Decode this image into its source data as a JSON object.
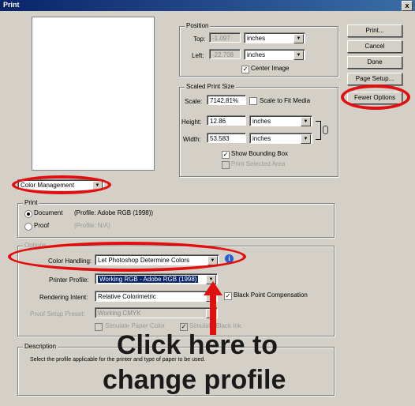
{
  "window": {
    "title": "Print",
    "close_glyph": "x"
  },
  "buttons": {
    "print": "Print...",
    "cancel": "Cancel",
    "done": "Done",
    "page_setup": "Page Setup...",
    "fewer_options": "Fewer Options"
  },
  "position": {
    "group_label": "Position",
    "top_label": "Top:",
    "top_value": "-1.097",
    "top_unit": "inches",
    "left_label": "Left:",
    "left_value": "-22.708",
    "left_unit": "inches",
    "center_image_label": "Center Image"
  },
  "scaled": {
    "group_label": "Scaled Print Size",
    "scale_label": "Scale:",
    "scale_value": "7142.81%",
    "scale_to_fit_label": "Scale to Fit Media",
    "height_label": "Height:",
    "height_value": "12.86",
    "height_unit": "inches",
    "width_label": "Width:",
    "width_value": "53.583",
    "width_unit": "inches",
    "show_bounding_box_label": "Show Bounding Box",
    "print_selected_area_label": "Print Selected Area"
  },
  "mode_dropdown": "Color Management",
  "print_group": {
    "label": "Print",
    "document_label": "Document",
    "document_profile": "(Profile: Adobe RGB (1998))",
    "proof_label": "Proof",
    "proof_profile": "(Profile: N/A)"
  },
  "options": {
    "group_label": "Options",
    "color_handling_label": "Color Handling:",
    "color_handling_value": "Let Photoshop Determine Colors",
    "printer_profile_label": "Printer Profile:",
    "printer_profile_value": "Working RGB - Adobe RGB (1998)",
    "rendering_intent_label": "Rendering Intent:",
    "rendering_intent_value": "Relative Colorimetric",
    "black_point_label": "Black Point Compensation",
    "proof_setup_label": "Proof Setup Preset:",
    "proof_setup_value": "Working CMYK",
    "simulate_paper_label": "Simulate Paper Color",
    "simulate_ink_label": "Simulate Black Ink"
  },
  "description": {
    "label": "Description",
    "text": "Select the profile applicable for the printer and type of paper to be used."
  },
  "annotation": {
    "line1": "Click here to",
    "line2": "change profile"
  },
  "colors": {
    "highlight": "#0a246a",
    "annotation_red": "#e01010"
  }
}
